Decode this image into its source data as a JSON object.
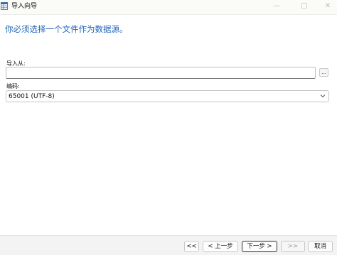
{
  "window": {
    "title": "导入向导",
    "app_icon": "table-grid-icon",
    "controls": {
      "minimize": "—",
      "maximize": "□",
      "close": "✕"
    }
  },
  "heading": "你必须选择一个文件作为数据源。",
  "import_from": {
    "label": "导入从:",
    "value": "",
    "browse_label": "..."
  },
  "encoding": {
    "label": "编码:",
    "selected": "65001 (UTF-8)"
  },
  "footer": {
    "first_label": "<<",
    "back_label": "< 上一步",
    "next_label": "下一步 >",
    "finish_label": ">>",
    "cancel_label": "取消"
  },
  "colors": {
    "heading": "#1e63b8",
    "titlebar": "#fbfbf7",
    "footer": "#f3f3f3"
  }
}
